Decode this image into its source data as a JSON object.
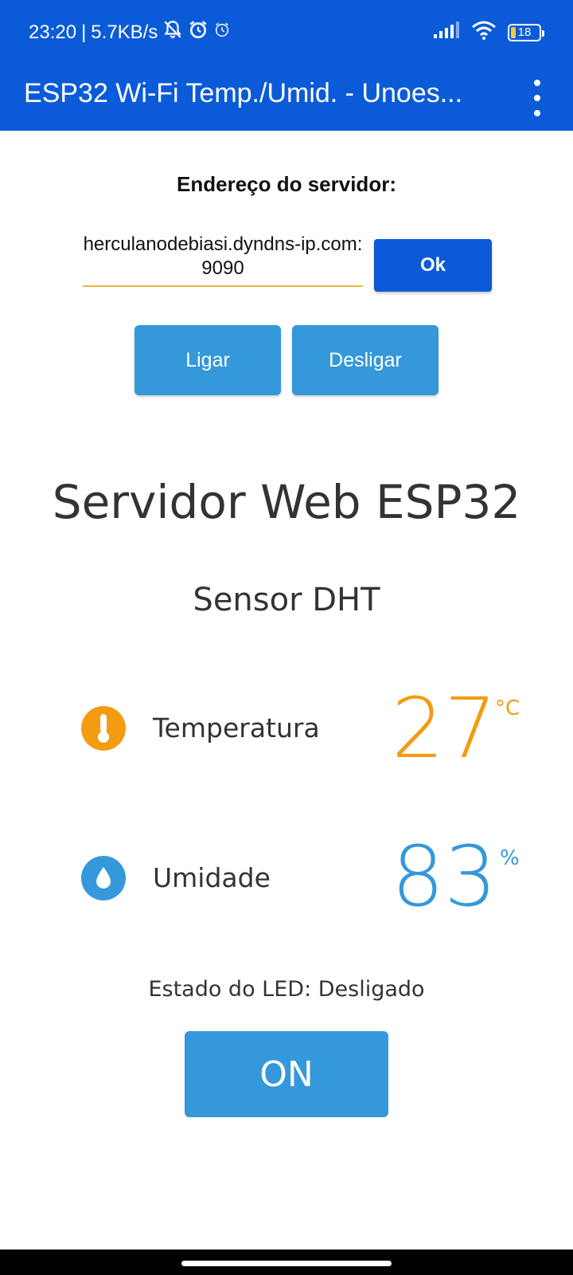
{
  "status_bar": {
    "time": "23:20",
    "separator": "|",
    "network_speed": "5.7KB/s",
    "battery_level": "18",
    "icons": [
      "bell-off-icon",
      "alarm-clock-icon",
      "alarm-icon",
      "signal-icon",
      "wifi-icon",
      "battery-icon"
    ]
  },
  "app_bar": {
    "title": "ESP32 Wi-Fi Temp./Umid. - Unoes...",
    "menu_icon": "more-vert-icon"
  },
  "server": {
    "label": "Endereço do servidor:",
    "address": "herculanodebiasi.dyndns-ip.com:9090",
    "ok_label": "Ok"
  },
  "controls": {
    "ligar_label": "Ligar",
    "desligar_label": "Desligar"
  },
  "web": {
    "title": "Servidor Web ESP32",
    "subtitle": "Sensor DHT",
    "temperature": {
      "label": "Temperatura",
      "value": "27",
      "unit": "°C",
      "icon": "thermometer-icon",
      "color": "#f39c12"
    },
    "humidity": {
      "label": "Umidade",
      "value": "83",
      "unit": "%",
      "icon": "water-drop-icon",
      "color": "#3498db"
    },
    "led_state": "Estado do LED: Desligado",
    "on_label": "ON"
  },
  "colors": {
    "app_bar": "#0b5bd9",
    "button": "#3498db",
    "input_underline": "#f0b73a"
  }
}
